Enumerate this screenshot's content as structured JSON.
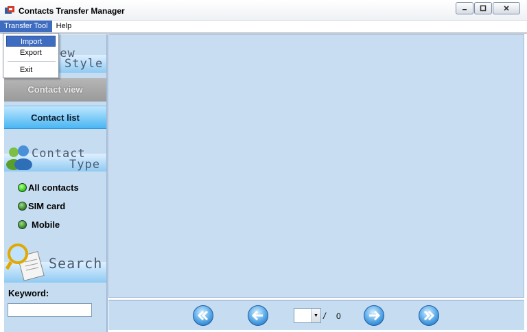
{
  "window": {
    "title": "Contacts Transfer Manager",
    "controls": {
      "minimize": "minimize",
      "maximize": "maximize",
      "close": "close"
    }
  },
  "menubar": {
    "items": [
      {
        "label": "Transfer Tool",
        "active": true
      },
      {
        "label": "Help",
        "active": false
      }
    ]
  },
  "dropdown": {
    "items": [
      {
        "label": "Import",
        "hover": true
      },
      {
        "label": "Export",
        "hover": false
      },
      {
        "label": "Exit",
        "hover": false
      }
    ]
  },
  "sidebar": {
    "view_style": {
      "word1": "iew",
      "word2": "Style"
    },
    "view_tabs": [
      {
        "label": "Contact view",
        "state": "disabled"
      },
      {
        "label": "Contact list",
        "state": "selected"
      }
    ],
    "contact_type": {
      "word1": "Contact",
      "word2": "Type",
      "options": [
        {
          "label": "All contacts",
          "selected": true
        },
        {
          "label": "SIM card",
          "selected": false
        },
        {
          "label": "Mobile",
          "selected": false
        }
      ]
    },
    "search": {
      "title": "Search",
      "keyword_label": "Keyword:",
      "keyword_value": ""
    }
  },
  "pagination": {
    "current_page": "",
    "separator": "/",
    "total_pages": "0"
  },
  "colors": {
    "panel_bg": "#c8ddf1",
    "accent": "#3d6cc0",
    "selected_tab": "#49b6f3"
  }
}
